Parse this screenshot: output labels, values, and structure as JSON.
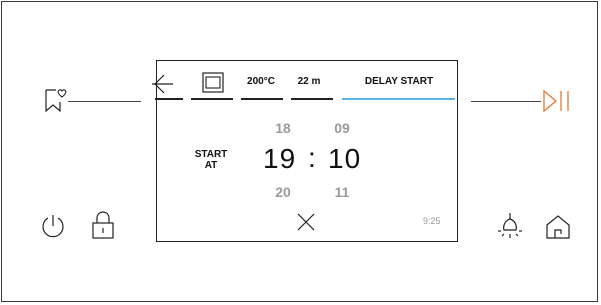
{
  "tabs": [
    {
      "label": "200°C"
    },
    {
      "label": "22 m"
    },
    {
      "label": "DELAY START"
    }
  ],
  "time_picker": {
    "start_label_line1": "START",
    "start_label_line2": "AT",
    "hour_prev": "18",
    "minute_prev": "09",
    "hour": "19",
    "separator": ":",
    "minute": "10",
    "hour_next": "20",
    "minute_next": "11"
  },
  "clock": "9:25",
  "colors": {
    "accent_play": "#e8762b",
    "active_tab": "#5ab2e6"
  },
  "icons": [
    "favorite-bookmark-icon",
    "play-pause-icon",
    "power-icon",
    "lock-icon",
    "oven-light-icon",
    "home-icon",
    "back-arrow-icon",
    "oven-mode-icon",
    "close-icon"
  ]
}
